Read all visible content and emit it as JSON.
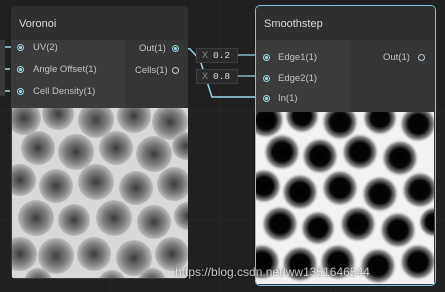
{
  "voronoi_node": {
    "title": "Voronoi",
    "inputs": [
      "UV(2)",
      "Angle Offset(1)",
      "Cell Density(1)"
    ],
    "outputs": [
      "Out(1)",
      "Cells(1)"
    ]
  },
  "smoothstep_node": {
    "title": "Smoothstep",
    "inputs": [
      "Edge1(1)",
      "Edge2(1)",
      "In(1)"
    ],
    "outputs": [
      "Out(1)"
    ]
  },
  "value_inputs": [
    {
      "axis": "X",
      "value": "0.2"
    },
    {
      "axis": "X",
      "value": "0.8"
    }
  ],
  "colors": {
    "accent": "#9ad7e8",
    "selected_border": "#7ec3e0",
    "node_body": "#3a3a3a",
    "canvas": "#202020"
  },
  "watermark": "https://blog.csdn.net/ww1351646544"
}
